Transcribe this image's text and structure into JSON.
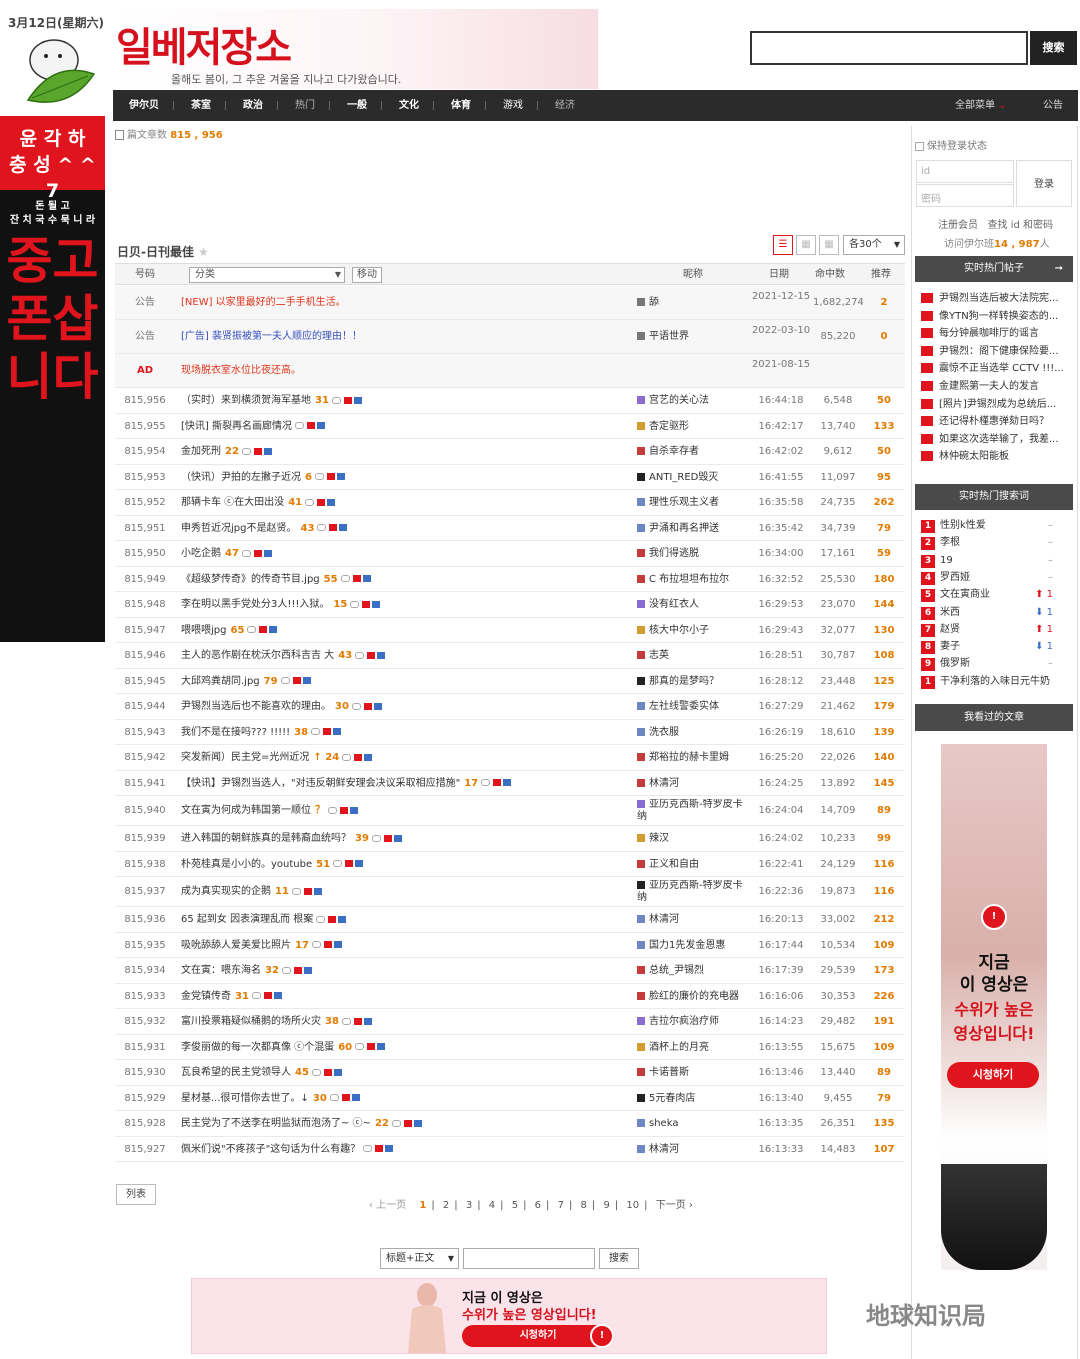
{
  "date": "3月12日(星期六)",
  "left_banner": {
    "line1": "윤 각 하",
    "line2": "충 성 ^ ^ 7",
    "line3": "돈 될 고",
    "line4": "잔 치 국 수 묵 니 라",
    "big": "중고폰삽니다"
  },
  "logo": {
    "text": "일베저장소",
    "tagline": "올해도 봄이, 그 추운 겨울을 지나고 다가왔습니다."
  },
  "search_button": "搜索",
  "nav": {
    "items": [
      "伊尔贝",
      "茶室",
      "政治",
      "热门",
      "一般",
      "文化",
      "体育",
      "游戏",
      "经济"
    ],
    "all_menu": "全部菜单",
    "notice": "公告"
  },
  "article_count": {
    "label": "篇文章数",
    "value": "815 , 956"
  },
  "board": {
    "title": "日贝-日刊最佳",
    "per_page": "各30个",
    "move": "移动",
    "category": "分类"
  },
  "columns": {
    "num": "号码",
    "nick": "昵称",
    "date": "日期",
    "views": "命中数",
    "rec": "推荐"
  },
  "notices": [
    {
      "num": "公告",
      "subject": "[NEW] 以家里最好的二手手机生活。",
      "nick": "舔",
      "date": "2021-12-15",
      "views": "1,682,274",
      "rec": "2"
    },
    {
      "num": "公告",
      "subject": "[广告] 裴贤振被第一夫人顺应的理由！！",
      "nick": "平语世界",
      "date": "2022-03-10",
      "views": "85,220",
      "rec": "0"
    },
    {
      "num": "AD",
      "subject": "现场脱衣室水位比夜还高。",
      "nick": "",
      "date": "2021-08-15",
      "views": "",
      "rec": ""
    }
  ],
  "rows": [
    {
      "num": "815,956",
      "subject": "（实时）来到横须贺海军基地",
      "c": "31",
      "nick": "宫艺的关心法",
      "date": "16:44:18",
      "views": "6,548",
      "rec": "50"
    },
    {
      "num": "815,955",
      "subject": "[快讯] 撕裂再名画廊情况",
      "c": "",
      "nick": "杏定驱形",
      "date": "16:42:17",
      "views": "13,740",
      "rec": "133"
    },
    {
      "num": "815,954",
      "subject": "金加死刑",
      "c": "22",
      "nick": "自杀幸存者",
      "date": "16:42:02",
      "views": "9,612",
      "rec": "50"
    },
    {
      "num": "815,953",
      "subject": "（快讯）尹拍的左撇子近况",
      "c": "6",
      "nick": "ANTI_RED毁灭",
      "date": "16:41:55",
      "views": "11,097",
      "rec": "95"
    },
    {
      "num": "815,952",
      "subject": "那辆卡车 ⓒ在大田出没",
      "c": "41",
      "nick": "理性乐观主义者",
      "date": "16:35:58",
      "views": "24,735",
      "rec": "262"
    },
    {
      "num": "815,951",
      "subject": "申秀哲近况jpg不是赵贤。",
      "c": "43",
      "nick": "尹涌和再名押送",
      "date": "16:35:42",
      "views": "34,739",
      "rec": "79"
    },
    {
      "num": "815,950",
      "subject": "小吃企鹅",
      "c": "47",
      "nick": "我们得逃脱",
      "date": "16:34:00",
      "views": "17,161",
      "rec": "59"
    },
    {
      "num": "815,949",
      "subject": "《超级梦传奇》的传奇节目.jpg",
      "c": "55",
      "nick": "C 布拉坦坦布拉尔",
      "date": "16:32:52",
      "views": "25,530",
      "rec": "180"
    },
    {
      "num": "815,948",
      "subject": "李在明以黑手党处分3人!!!入狱。",
      "c": "15",
      "nick": "没有红衣人",
      "date": "16:29:53",
      "views": "23,070",
      "rec": "144"
    },
    {
      "num": "815,947",
      "subject": "喂喂喂jpg",
      "c": "65",
      "nick": "核大中尔小子",
      "date": "16:29:43",
      "views": "32,077",
      "rec": "130"
    },
    {
      "num": "815,946",
      "subject": "主人的恶作剧在枕沃尔西科吉吉 大",
      "c": "43",
      "nick": "志英",
      "date": "16:28:51",
      "views": "30,787",
      "rec": "108"
    },
    {
      "num": "815,945",
      "subject": "大邱鸡粪胡同.jpg",
      "c": "79",
      "nick": "那真的是梦吗？",
      "date": "16:28:12",
      "views": "23,448",
      "rec": "125"
    },
    {
      "num": "815,944",
      "subject": "尹锡烈当选后也不能喜欢的理由。",
      "c": "30",
      "nick": "左社线警委实体",
      "date": "16:27:29",
      "views": "21,462",
      "rec": "179"
    },
    {
      "num": "815,943",
      "subject": "我们不是在接吗??? !!!!!",
      "c": "38",
      "nick": "洗衣服",
      "date": "16:26:19",
      "views": "18,610",
      "rec": "139"
    },
    {
      "num": "815,942",
      "subject": "突发新闻）民主党=光州近况",
      "c": "↑ 24",
      "nick": "郑裕拉的赫卡里姆",
      "date": "16:25:20",
      "views": "22,026",
      "rec": "140"
    },
    {
      "num": "815,941",
      "subject": "【快讯】尹锡烈当选人，\"对违反朝鲜安理会决议采取相应措施\"",
      "c": "17",
      "nick": "林清河",
      "date": "16:24:25",
      "views": "13,892",
      "rec": "145"
    },
    {
      "num": "815,940",
      "subject": "文在寅为何成为韩国第一顺位",
      "c": "？",
      "nick": "亚历克西斯-特罗皮卡纳",
      "date": "16:24:04",
      "views": "14,709",
      "rec": "89"
    },
    {
      "num": "815,939",
      "subject": "进入韩国的朝鲜族真的是韩裔血统吗？",
      "c": "39",
      "nick": "辣汉",
      "date": "16:24:02",
      "views": "10,233",
      "rec": "99"
    },
    {
      "num": "815,938",
      "subject": "朴苑桂真是小小的。youtube",
      "c": "51",
      "nick": "正义和自由",
      "date": "16:22:41",
      "views": "24,129",
      "rec": "116"
    },
    {
      "num": "815,937",
      "subject": "成为真实现实的企鹅",
      "c": "11",
      "nick": "亚历克西斯-特罗皮卡纳",
      "date": "16:22:36",
      "views": "19,873",
      "rec": "116"
    },
    {
      "num": "815,936",
      "subject": "65 起到女 因表演理乱而 根案",
      "c": "",
      "nick": "林清河",
      "date": "16:20:13",
      "views": "33,002",
      "rec": "212"
    },
    {
      "num": "815,935",
      "subject": "吸吮舔舔人爱美爱比照片",
      "c": "17",
      "nick": "国力1先发金恩惠",
      "date": "16:17:44",
      "views": "10,534",
      "rec": "109"
    },
    {
      "num": "815,934",
      "subject": "文在寅：喂东海名",
      "c": "32",
      "nick": "总统_尹锡烈",
      "date": "16:17:39",
      "views": "29,539",
      "rec": "173"
    },
    {
      "num": "815,933",
      "subject": "金党镇传奇",
      "c": "31",
      "nick": "脸红的廉价的充电器",
      "date": "16:16:06",
      "views": "30,353",
      "rec": "226"
    },
    {
      "num": "815,932",
      "subject": "富川投票箱疑似桶鹅的场所火灾",
      "c": "38",
      "nick": "吉拉尔疯治疗师",
      "date": "16:14:23",
      "views": "29,482",
      "rec": "191"
    },
    {
      "num": "815,931",
      "subject": "李俊丽做的每一次都真像 ⓒ个混蛋",
      "c": "60",
      "nick": "酒杯上的月亮",
      "date": "16:13:55",
      "views": "15,675",
      "rec": "109"
    },
    {
      "num": "815,930",
      "subject": "瓦良希望的民主党领导人",
      "c": "45",
      "nick": "卡诺普斯",
      "date": "16:13:46",
      "views": "13,440",
      "rec": "89"
    },
    {
      "num": "815,929",
      "subject": "星材基...很可惜你去世了。↓",
      "c": "30",
      "nick": "5元春肉店",
      "date": "16:13:40",
      "views": "9,455",
      "rec": "79"
    },
    {
      "num": "815,928",
      "subject": "民主党为了不送李在明监狱而泡汤了~ ⓒ~",
      "c": "22",
      "nick": "sheka",
      "date": "16:13:35",
      "views": "26,351",
      "rec": "135"
    },
    {
      "num": "815,927",
      "subject": "佩米们说\"不疼孩子\"这句话为什么有趣？",
      "c": "",
      "nick": "林清河",
      "date": "16:13:33",
      "views": "14,483",
      "rec": "107"
    }
  ],
  "list_button": "列表",
  "pager": {
    "prev": "‹ 上一页",
    "pages": [
      "1",
      "2",
      "3",
      "4",
      "5",
      "6",
      "7",
      "8",
      "9",
      "10"
    ],
    "next": "下一页 ›"
  },
  "bottom_search": {
    "select": "标题+正文",
    "button": "搜索"
  },
  "bottom_ad": {
    "line1": "지금 이 영상은",
    "line2": "수위가 높은 영상입니다!",
    "button": "시청하기"
  },
  "sidebar": {
    "keep_login": "保持登录状态",
    "id_placeholder": "id",
    "pw_placeholder": "密码",
    "login": "登录",
    "register": "注册会员",
    "find": "查找 id 和密码",
    "visit_label": "访问伊尔班",
    "visit_value": "14 , 987",
    "visit_suffix": "人",
    "hot_title": "实时热门帖子",
    "hot_posts": [
      "尹锡烈当选后被大法院宪...",
      "像YTN狗一样转换姿态的...",
      "每分钟晨咖啡厅的谣言",
      "尹锡烈：阁下健康保险要...",
      "震惊不正当选举 CCTV !!!...",
      "金建熙第一夫人的发言",
      "[照片]尹锡烈成为总统后...",
      "还记得朴槿惠弹劾日吗？",
      "如果这次选举输了，我差...",
      "林仲碗太阳能板"
    ],
    "kw_title": "实时热门搜索词",
    "keywords": [
      {
        "n": "1",
        "w": "性别k性爱",
        "t": "–"
      },
      {
        "n": "2",
        "w": "李根",
        "t": "–"
      },
      {
        "n": "3",
        "w": "19",
        "t": "–"
      },
      {
        "n": "4",
        "w": "罗西娅",
        "t": "–"
      },
      {
        "n": "5",
        "w": "文在寅商业",
        "t": "⬆ 1"
      },
      {
        "n": "6",
        "w": "米西",
        "t": "⬇ 1"
      },
      {
        "n": "7",
        "w": "赵贤",
        "t": "⬆ 1"
      },
      {
        "n": "8",
        "w": "妻子",
        "t": "⬇ 1"
      },
      {
        "n": "9",
        "w": "俄罗斯",
        "t": "–"
      },
      {
        "n": "1",
        "w": "干净利落的入味日元牛奶",
        "t": ""
      }
    ],
    "seen_title": "我看过的文章",
    "ad_line1": "지금",
    "ad_line2": "이 영상은",
    "ad_line3": "수위가 높은",
    "ad_line4": "영상입니다!",
    "ad_button": "시청하기"
  },
  "watermark": "地球知识局"
}
